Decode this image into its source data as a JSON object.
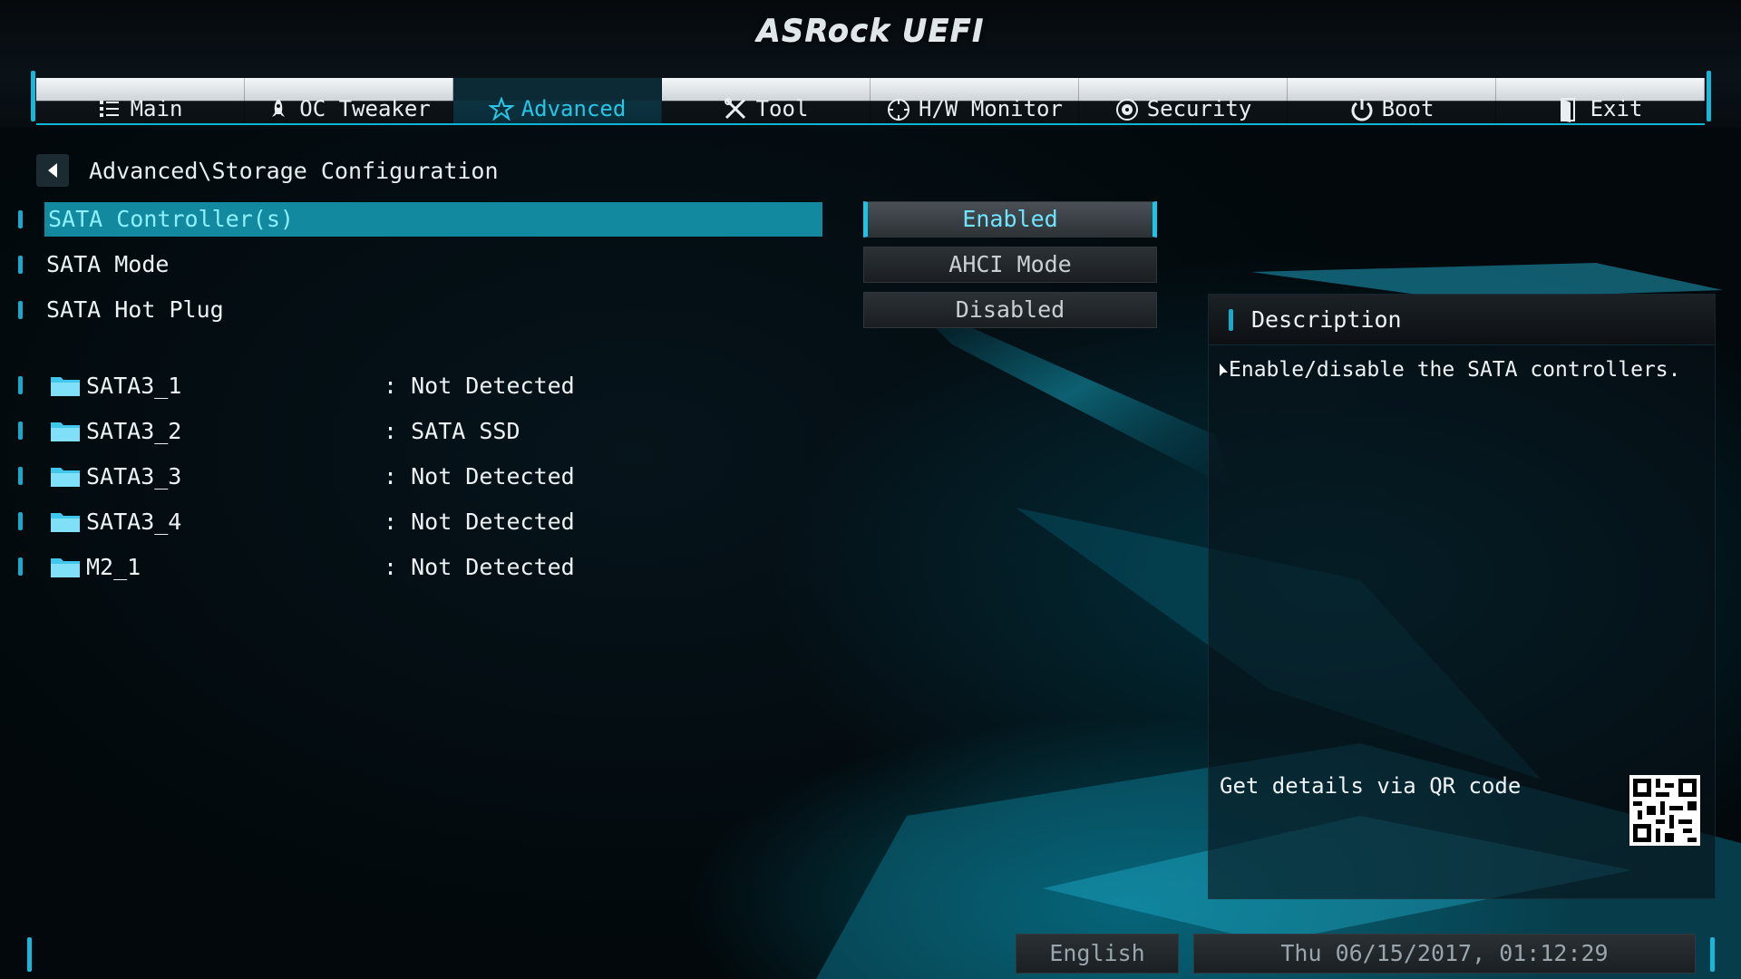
{
  "header": {
    "logo": "ASRock UEFI"
  },
  "tabs": [
    {
      "label": "Main",
      "icon": "list-icon",
      "active": false
    },
    {
      "label": "OC Tweaker",
      "icon": "rocket-icon",
      "active": false
    },
    {
      "label": "Advanced",
      "icon": "star-icon",
      "active": true
    },
    {
      "label": "Tool",
      "icon": "tools-icon",
      "active": false
    },
    {
      "label": "H/W Monitor",
      "icon": "crosshair-icon",
      "active": false
    },
    {
      "label": "Security",
      "icon": "shield-icon",
      "active": false
    },
    {
      "label": "Boot",
      "icon": "power-icon",
      "active": false
    },
    {
      "label": "Exit",
      "icon": "exit-door-icon",
      "active": false
    }
  ],
  "breadcrumb": {
    "path": "Advanced\\Storage Configuration"
  },
  "settings": [
    {
      "label": "SATA Controller(s)",
      "value": "Enabled",
      "selected": true
    },
    {
      "label": "SATA Mode",
      "value": "AHCI Mode",
      "selected": false
    },
    {
      "label": "SATA Hot Plug",
      "value": "Disabled",
      "selected": false
    }
  ],
  "devices": [
    {
      "name": "SATA3_1",
      "status": ": Not Detected"
    },
    {
      "name": "SATA3_2",
      "status": ": SATA SSD"
    },
    {
      "name": "SATA3_3",
      "status": ": Not Detected"
    },
    {
      "name": "SATA3_4",
      "status": ": Not Detected"
    },
    {
      "name": "M2_1",
      "status": ": Not Detected"
    }
  ],
  "description": {
    "title": "Description",
    "text": "Enable/disable the SATA controllers.",
    "qr_label": "Get details via QR code"
  },
  "footer": {
    "language": "English",
    "datetime": "Thu 06/15/2017, 01:12:29"
  },
  "colors": {
    "accent": "#1ec4e8",
    "selected_row": "#12899f"
  }
}
